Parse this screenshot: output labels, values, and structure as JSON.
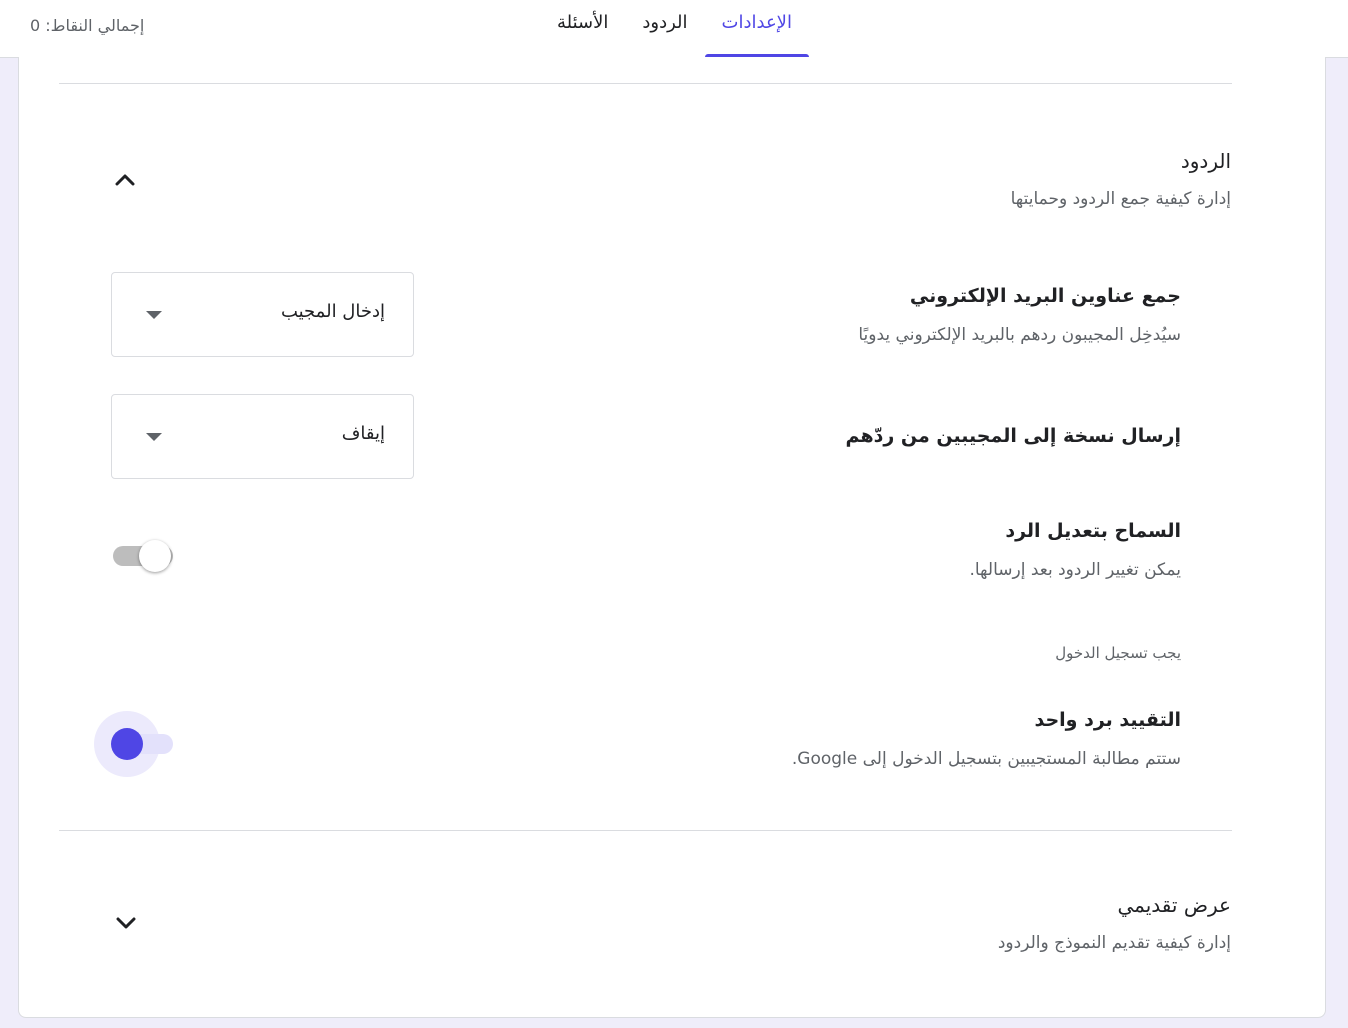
{
  "header": {
    "total_points": "إجمالي النقاط: 0",
    "tabs": [
      {
        "label": "الأسئلة"
      },
      {
        "label": "الردود"
      },
      {
        "label": "الإعدادات"
      }
    ]
  },
  "responses_section": {
    "title": "الردود",
    "description": "إدارة كيفية جمع الردود وحمايتها",
    "collect_emails": {
      "title": "جمع عناوين البريد الإلكتروني",
      "description": "سيُدخِل المجيبون ردهم بالبريد الإلكتروني يدويًا",
      "selected": "إدخال المجيب"
    },
    "send_copy": {
      "title": "إرسال نسخة إلى المجيبين من ردّهم",
      "selected": "إيقاف"
    },
    "allow_edit": {
      "title": "السماح بتعديل الرد",
      "description": "يمكن تغيير الردود بعد إرسالها.",
      "enabled": false
    },
    "requires_sign_in_note": "يجب تسجيل الدخول",
    "limit_one": {
      "title": "التقييد برد واحد",
      "description": "ستتم مطالبة المستجيبين بتسجيل الدخول إلى Google.",
      "enabled": true
    }
  },
  "presentation_section": {
    "title": "عرض تقديمي",
    "description": "إدارة كيفية تقديم النموذج والردود"
  },
  "colors": {
    "accent": "#4f46e5",
    "background": "#efedfa"
  }
}
